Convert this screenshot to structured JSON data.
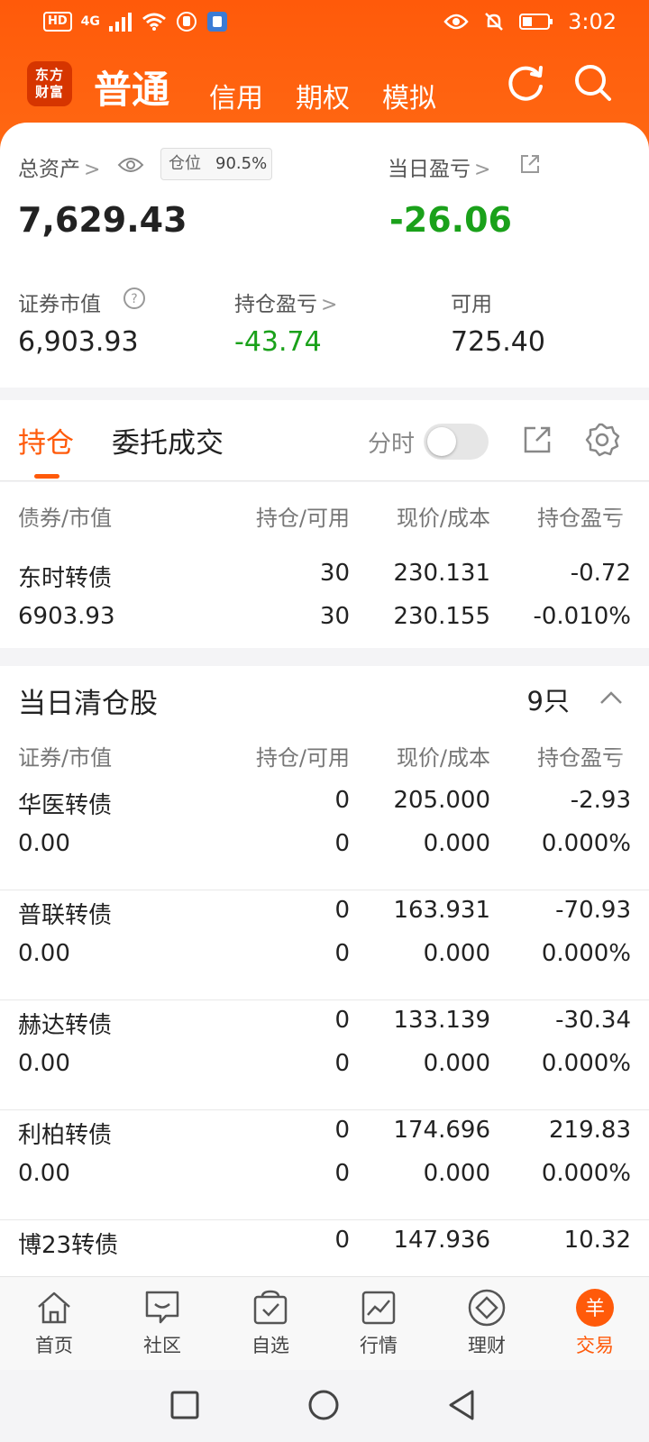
{
  "status_bar": {
    "left_chips": [
      "HD",
      "4G"
    ],
    "time": "3:02"
  },
  "header": {
    "logo_text_1": "东方",
    "logo_text_2": "财富",
    "tabs": [
      "普通",
      "信用",
      "期权",
      "模拟"
    ],
    "active_tab": "普通",
    "refresh_icon": "refresh-icon",
    "search_icon": "search-icon",
    "brand_color": "#FF5A0A"
  },
  "summary": {
    "total_assets_label": "总资产",
    "position_label": "仓位",
    "position_value": "90.5%",
    "total_assets_value": "7,629.43",
    "daily_pnl_label": "当日盈亏",
    "daily_pnl_value": "-26.06",
    "securities_value_label": "证券市值",
    "securities_value": "6,903.93",
    "holding_pnl_label": "持仓盈亏",
    "holding_pnl_value": "-43.74",
    "available_label": "可用",
    "available_value": "725.40"
  },
  "tabs": {
    "active": "持仓",
    "inactive": "委托成交",
    "toggle_label": "分时",
    "toggle_on": false
  },
  "holdings": {
    "headers": [
      "债券/市值",
      "持仓/可用",
      "现价/成本",
      "持仓盈亏"
    ],
    "rows": [
      {
        "name": "东时转债",
        "market_value": "6903.93",
        "position": "30",
        "available": "30",
        "price": "230.131",
        "cost": "230.155",
        "pnl": "-0.72",
        "pnl_pct": "-0.010%",
        "direction": "down"
      }
    ]
  },
  "cleared": {
    "title": "当日清仓股",
    "count": "9只",
    "headers": [
      "证券/市值",
      "持仓/可用",
      "现价/成本",
      "持仓盈亏"
    ],
    "rows": [
      {
        "name": "华医转债",
        "market_value": "0.00",
        "position": "0",
        "available": "0",
        "price": "205.000",
        "cost": "0.000",
        "pnl": "-2.93",
        "pnl_pct": "0.000%",
        "direction": "down"
      },
      {
        "name": "普联转债",
        "market_value": "0.00",
        "position": "0",
        "available": "0",
        "price": "163.931",
        "cost": "0.000",
        "pnl": "-70.93",
        "pnl_pct": "0.000%",
        "direction": "down"
      },
      {
        "name": "赫达转债",
        "market_value": "0.00",
        "position": "0",
        "available": "0",
        "price": "133.139",
        "cost": "0.000",
        "pnl": "-30.34",
        "pnl_pct": "0.000%",
        "direction": "down"
      },
      {
        "name": "利柏转债",
        "market_value": "0.00",
        "position": "0",
        "available": "0",
        "price": "174.696",
        "cost": "0.000",
        "pnl": "219.83",
        "pnl_pct": "0.000%",
        "direction": "up"
      },
      {
        "name": "博23转债",
        "position": "0",
        "price": "147.936",
        "pnl": "10.32",
        "direction": "up"
      }
    ]
  },
  "bottom_nav": {
    "items": [
      "首页",
      "社区",
      "自选",
      "行情",
      "理财",
      "交易"
    ],
    "active": "交易",
    "trade_glyph": "羊"
  }
}
